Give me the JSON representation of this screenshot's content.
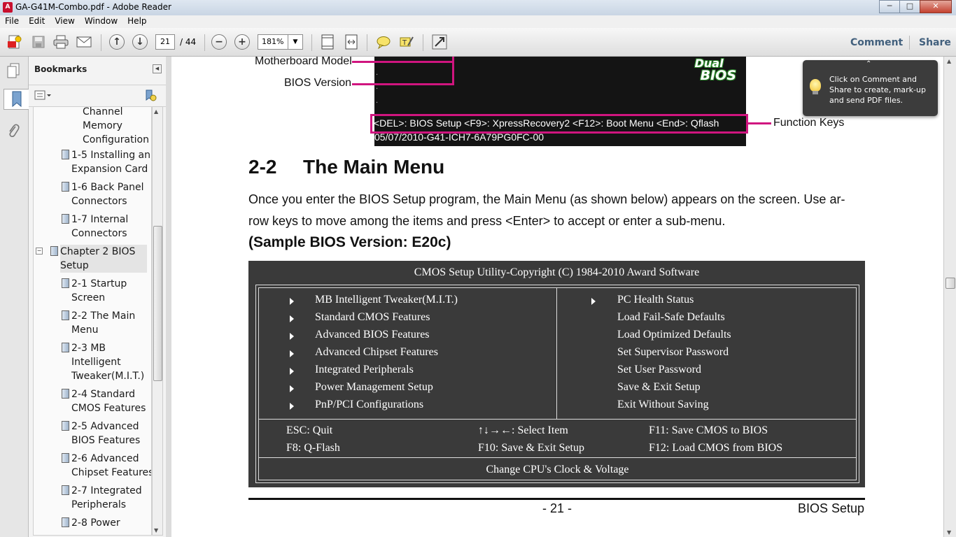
{
  "window": {
    "title": "GA-G41M-Combo.pdf - Adobe Reader"
  },
  "menu": [
    "File",
    "Edit",
    "View",
    "Window",
    "Help"
  ],
  "toolbar": {
    "page_current": "21",
    "page_total": "/ 44",
    "zoom": "181%",
    "comment_label": "Comment",
    "share_label": "Share"
  },
  "bookmarks": {
    "header": "Bookmarks",
    "items": [
      {
        "label": "Channel\nMemory\nConfiguration"
      },
      {
        "label": "1-5 Installing an\nExpansion Card"
      },
      {
        "label": "1-6 Back Panel\nConnectors"
      },
      {
        "label": "1-7 Internal\nConnectors"
      },
      {
        "label": "Chapter 2 BIOS\nSetup"
      },
      {
        "label": "2-1 Startup\nScreen"
      },
      {
        "label": "2-2 The Main\nMenu"
      },
      {
        "label": "2-3 MB\nIntelligent\nTweaker(M.I.T.)"
      },
      {
        "label": "2-4 Standard\nCMOS Features"
      },
      {
        "label": "2-5 Advanced\nBIOS Features"
      },
      {
        "label": "2-6 Advanced\nChipset Features"
      },
      {
        "label": "2-7 Integrated\nPeripherals"
      },
      {
        "label": "2-8 Power"
      }
    ]
  },
  "doc": {
    "callouts": {
      "model": "Motherboard Model",
      "bios": "BIOS Version",
      "fkeys": "Function Keys"
    },
    "bios_logo": {
      "line1": "Dual",
      "line2": "BIOS"
    },
    "function_keys": "<DEL>: BIOS Setup  <F9>: XpressRecovery2  <F12>: Boot Menu  <End>: Qflash",
    "bios_string": "05/07/2010-G41-ICH7-6A79PG0FC-00",
    "section_num": "2-2",
    "section_title": "The Main Menu",
    "para_line1": "Once you enter the BIOS Setup program, the Main Menu (as shown below) appears on the screen. Use ar-",
    "para_line2": "row keys to move among the items and press <Enter> to accept or enter a sub-menu.",
    "sample": "(Sample BIOS Version: E20c)",
    "cmos": {
      "title": "CMOS Setup Utility-Copyright (C) 1984-2010 Award Software",
      "left": [
        "MB Intelligent Tweaker(M.I.T.)",
        "Standard CMOS Features",
        "Advanced BIOS Features",
        "Advanced Chipset Features",
        "Integrated Peripherals",
        "Power Management Setup",
        "PnP/PCI Configurations"
      ],
      "right": [
        "PC Health Status",
        "Load Fail-Safe Defaults",
        "Load Optimized Defaults",
        "Set Supervisor Password",
        "Set User Password",
        "Save & Exit Setup",
        "Exit Without Saving"
      ],
      "keys": [
        "ESC: Quit",
        "↑↓→←: Select Item",
        "F11: Save CMOS to BIOS",
        "F8: Q-Flash",
        "F10: Save & Exit Setup",
        "F12: Load CMOS from BIOS"
      ],
      "status": "Change CPU's Clock & Voltage"
    },
    "footer_page": "- 21 -",
    "footer_section": "BIOS Setup"
  },
  "tooltip": {
    "text": "Click on Comment and Share to create, mark-up and send PDF files."
  }
}
